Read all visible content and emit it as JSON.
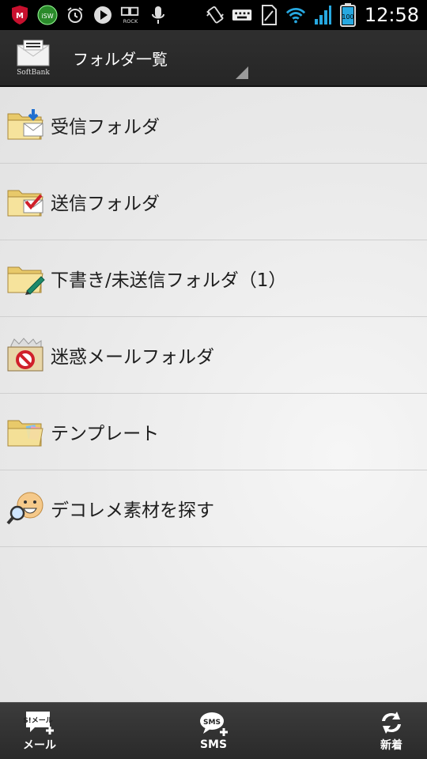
{
  "status_bar": {
    "time": "12:58",
    "battery": "100",
    "icons": [
      "mcafee-icon",
      "isw-icon",
      "alarm-icon",
      "play-icon",
      "radio-rock-icon",
      "mic-icon",
      "vibrate-icon",
      "keyboard-icon",
      "sim-icon",
      "wifi-icon",
      "signal-icon",
      "battery-icon"
    ]
  },
  "app_bar": {
    "logo_text": "SoftBank",
    "title": "フォルダ一覧"
  },
  "folders": [
    {
      "label": "受信フォルダ",
      "icon": "inbox-folder-icon"
    },
    {
      "label": "送信フォルダ",
      "icon": "sent-folder-icon"
    },
    {
      "label": "下書き/未送信フォルダ（1）",
      "icon": "draft-folder-icon"
    },
    {
      "label": "迷惑メールフォルダ",
      "icon": "spam-folder-icon"
    },
    {
      "label": "テンプレート",
      "icon": "template-folder-icon"
    },
    {
      "label": "デコレメ素材を探す",
      "icon": "deco-search-icon"
    }
  ],
  "bottom_bar": {
    "mail_icon_text": "S!メール",
    "mail_label": "メール",
    "sms_icon_text": "SMS",
    "sms_label": "SMS",
    "refresh_label": "新着"
  },
  "colors": {
    "app_bar": "#2b2b2b",
    "list_bg": "#ececec",
    "divider": "#cfcfcf",
    "text": "#1e1e1e"
  }
}
